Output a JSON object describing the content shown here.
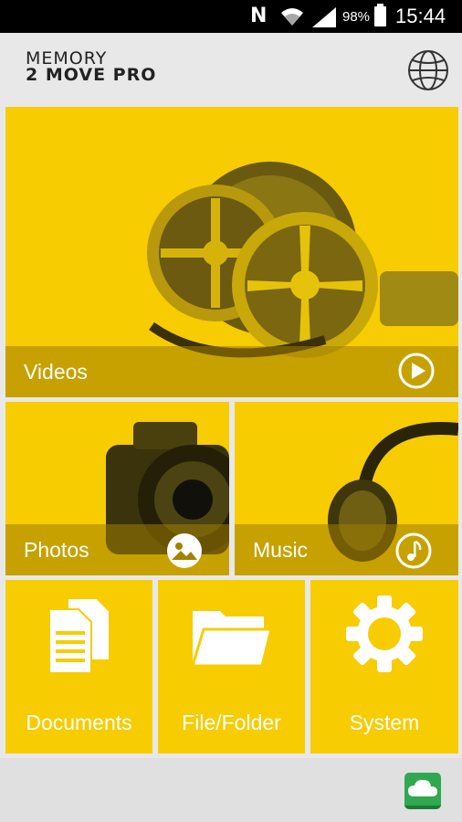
{
  "status": {
    "notification_letter": "N",
    "battery_percent": "98%",
    "time": "15:44"
  },
  "header": {
    "logo_line1": "MEMORY",
    "logo_line2": "2 MOVE PRO",
    "globe_icon": "globe-icon"
  },
  "tiles": {
    "videos": {
      "label": "Videos",
      "icon": "play-icon"
    },
    "photos": {
      "label": "Photos",
      "icon": "photo-icon"
    },
    "music": {
      "label": "Music",
      "icon": "music-note-icon"
    },
    "documents": {
      "label": "Documents",
      "icon": "documents-icon"
    },
    "file_folder": {
      "label": "File/Folder",
      "icon": "folder-icon"
    },
    "system": {
      "label": "System",
      "icon": "gear-icon"
    }
  },
  "footer": {
    "cloud_icon": "cloud-icon"
  },
  "colors": {
    "tile_yellow": "#f7cc00",
    "cloud_green": "#2fa84f",
    "status_black": "#000000"
  }
}
